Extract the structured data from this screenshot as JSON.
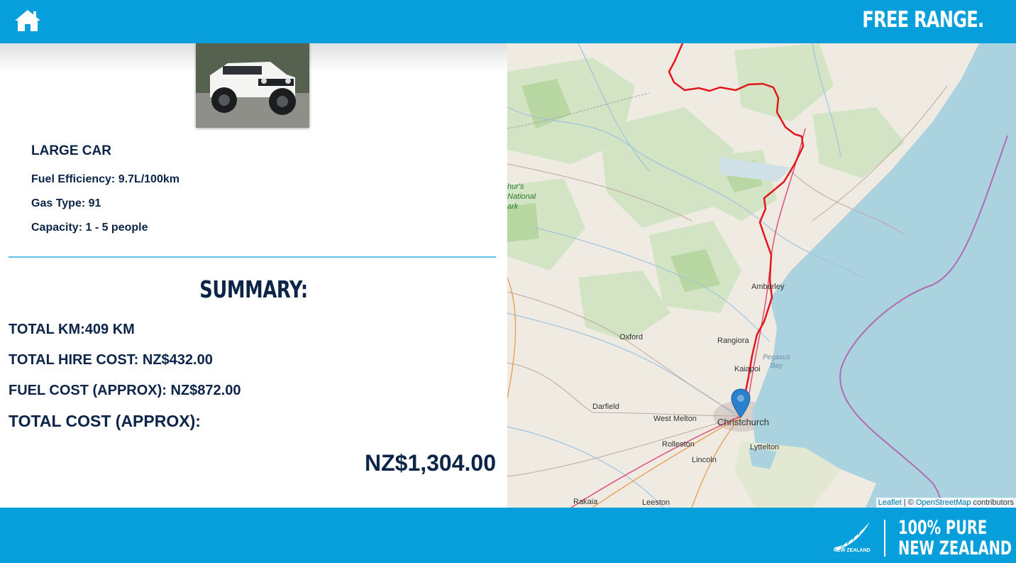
{
  "header": {
    "home_icon": "home-icon",
    "brand": "FREE RANGE."
  },
  "vehicle": {
    "photo_icon": "car-photo",
    "title": "LARGE CAR",
    "fuel_efficiency": "Fuel Efficiency: 9.7L/100km",
    "gas_type": "Gas Type: 91",
    "capacity": "Capacity: 1 - 5 people"
  },
  "summary": {
    "title": "SUMMARY:",
    "total_km": "TOTAL KM:409 KM",
    "hire_cost": "TOTAL HIRE COST: NZ$432.00",
    "fuel_cost": "FUEL COST (APPROX): NZ$872.00",
    "total_label": "TOTAL COST (APPROX):",
    "total_value": "NZ$1,304.00"
  },
  "map": {
    "labels": {
      "park": "hur's\nNational\nark",
      "amberley": "Amberley",
      "oxford": "Oxford",
      "rangiora": "Rangiora",
      "kaiapoi": "Kaiapoi",
      "pegasus_bay": "Pegasus\nBay",
      "darfield": "Darfield",
      "west_melton": "West Melton",
      "christchurch": "Christchurch",
      "rolleston": "Rolleston",
      "lyttelton": "Lyttelton",
      "lincoln": "Lincoln",
      "rakaia": "Rakaia",
      "leeston": "Leeston"
    },
    "marker_icon": "map-pin-icon",
    "route_color": "#e3161b",
    "attribution": {
      "leaflet": "Leaflet",
      "separator": " | © ",
      "osm": "OpenStreetMap",
      "suffix": " contributors"
    }
  },
  "footer": {
    "logo_icon": "silver-fern-icon",
    "tourism_label": "NEW ZEALAND",
    "pure_line1": "100% PURE",
    "pure_line2": "NEW ZEALAND"
  },
  "colors": {
    "brand_blue": "#069fdc",
    "text_navy": "#0b2447",
    "divider": "#5ec2ea",
    "sea": "#aad3df"
  }
}
